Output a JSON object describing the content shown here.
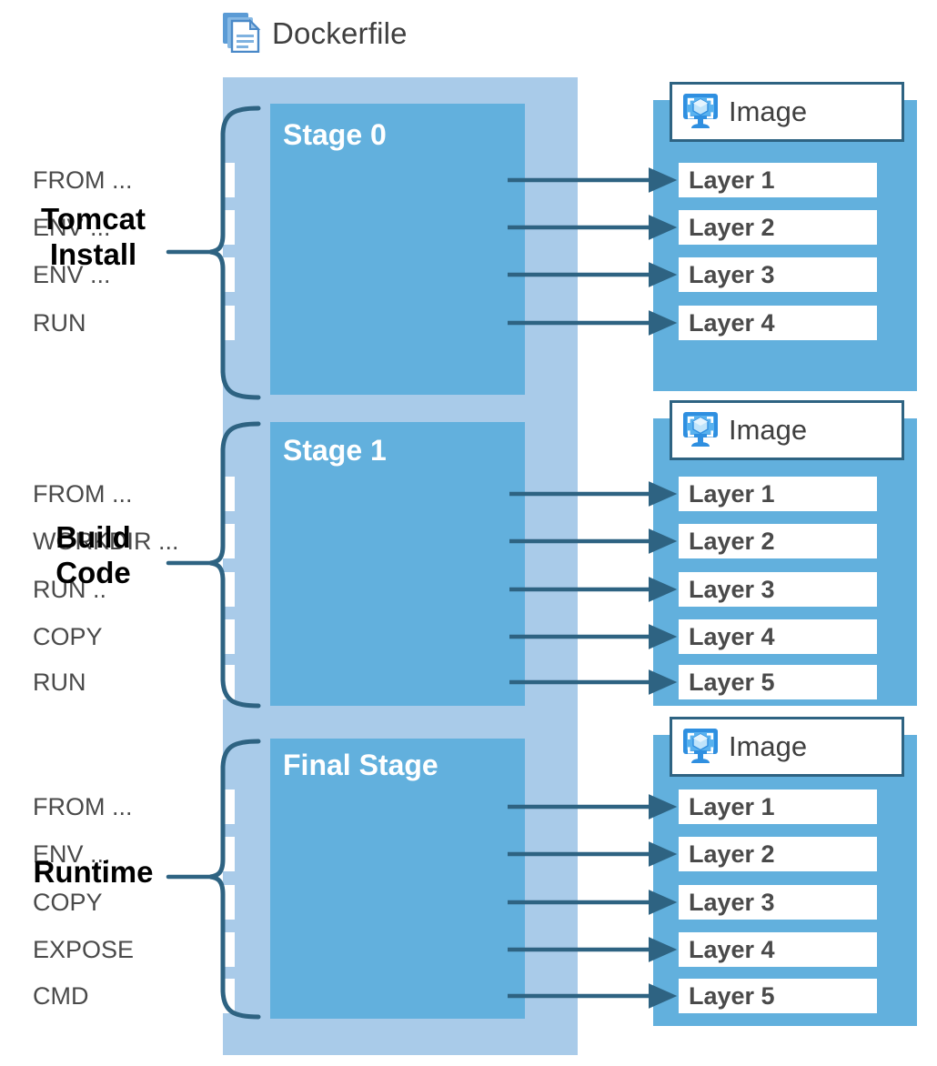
{
  "diagram": {
    "title": "Dockerfile",
    "title_icon": "documents-icon",
    "colors": {
      "panel": "#a9cbe9",
      "stage": "#62b0dd",
      "box": "#ffffff",
      "arrow": "#2e6382",
      "text": "#4a4a4a",
      "stage_title": "#ffffff",
      "group_label": "#000000"
    },
    "groups": [
      {
        "label": "Tomcat\nInstall"
      },
      {
        "label": "Build\nCode"
      },
      {
        "label": "Runtime"
      }
    ],
    "stages": [
      {
        "name": "Stage 0",
        "instructions": [
          "FROM ...",
          "ENV ...",
          "ENV ...",
          "RUN"
        ],
        "image": {
          "title": "Image",
          "icon": "container-image-icon",
          "layers": [
            "Layer 1",
            "Layer 2",
            "Layer 3",
            "Layer 4"
          ]
        }
      },
      {
        "name": "Stage 1",
        "instructions": [
          "FROM ...",
          "WORKDIR ...",
          "RUN ..",
          "COPY",
          "RUN"
        ],
        "image": {
          "title": "Image",
          "icon": "container-image-icon",
          "layers": [
            "Layer 1",
            "Layer 2",
            "Layer 3",
            "Layer 4",
            "Layer 5"
          ]
        }
      },
      {
        "name": "Final Stage",
        "instructions": [
          "FROM ...",
          "ENV ...",
          "COPY",
          "EXPOSE",
          "CMD"
        ],
        "image": {
          "title": "Image",
          "icon": "container-image-icon",
          "layers": [
            "Layer 1",
            "Layer 2",
            "Layer 3",
            "Layer 4",
            "Layer 5"
          ]
        }
      }
    ]
  }
}
